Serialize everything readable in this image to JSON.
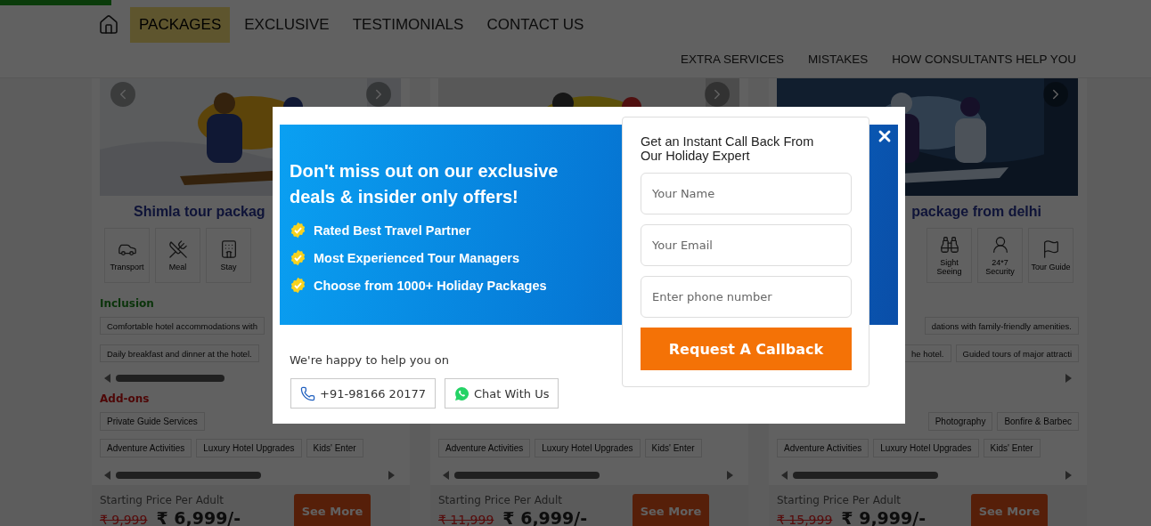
{
  "top_nav": [
    {
      "label": "PACKAGES",
      "selected": true
    },
    {
      "label": "EXCLUSIVE",
      "selected": false
    },
    {
      "label": "TESTIMONIALS",
      "selected": false
    },
    {
      "label": "CONTACT US",
      "selected": false
    }
  ],
  "sub_nav": [
    "EXTRA SERVICES",
    "MISTAKES",
    "HOW CONSULTANTS HELP YOU"
  ],
  "cards": [
    {
      "title": "Shimla tour packag",
      "amenities": [
        {
          "kind": "transport",
          "label": "Transport"
        },
        {
          "kind": "meal",
          "label": "Meal"
        },
        {
          "kind": "stay",
          "label": "Stay"
        }
      ],
      "inclusion_label": "Inclusion",
      "inclusions": [
        [
          "Comfortable hotel accommodations with"
        ],
        [
          "Daily breakfast and dinner at the hotel."
        ]
      ],
      "addons_label": "Add-ons",
      "addons": [
        [
          "Private Guide Services"
        ],
        [
          "Adventure Activities",
          "Luxury Hotel Upgrades",
          "Kids' Enter"
        ]
      ],
      "price_label": "Starting Price Per Adult",
      "old_price": "₹ 9,999",
      "price": "₹ 6,999/-",
      "button": "See More"
    },
    {
      "addons": [
        [
          "Adventure Activities",
          "Luxury Hotel Upgrades",
          "Kids' Enter"
        ]
      ],
      "price_label": "Starting Price Per Adult",
      "old_price": "₹ 11,999",
      "price": "₹ 6,999/-",
      "button": "See More"
    },
    {
      "title": "package from delhi",
      "amenities": [
        {
          "kind": "sightseeing",
          "label": "Sight Seeing"
        },
        {
          "kind": "security",
          "label": "24*7 Security"
        },
        {
          "kind": "guide",
          "label": "Tour Guide"
        }
      ],
      "inclusions": [
        [
          "dations with family-friendly amenities."
        ],
        [
          "he hotel.",
          "Guided tours of major attracti"
        ]
      ],
      "addons": [
        [
          "Photography",
          "Bonfire & Barbec"
        ],
        [
          "Adventure Activities",
          "Luxury Hotel Upgrades",
          "Kids' Enter"
        ]
      ],
      "price_label": "Starting Price Per Adult",
      "old_price": "₹ 15,999",
      "price": "₹ 9,999/-",
      "button": "See More"
    }
  ],
  "popup": {
    "headline": "Don't miss out on our exclusive deals & insider only offers!",
    "benefits": [
      "Rated Best Travel Partner",
      "Most Experienced Tour Managers",
      "Choose from 1000+ Holiday Packages"
    ],
    "help_text": "We're happy to help you on",
    "phone": "+91-98166 20177",
    "chat": "Chat With Us",
    "form": {
      "title": "Get an Instant Call Back From Our Holiday Expert",
      "fields": [
        {
          "placeholder": "Your Name"
        },
        {
          "placeholder": "Your Email"
        },
        {
          "placeholder": "Enter phone number"
        }
      ],
      "submit": "Request A Callback"
    }
  }
}
